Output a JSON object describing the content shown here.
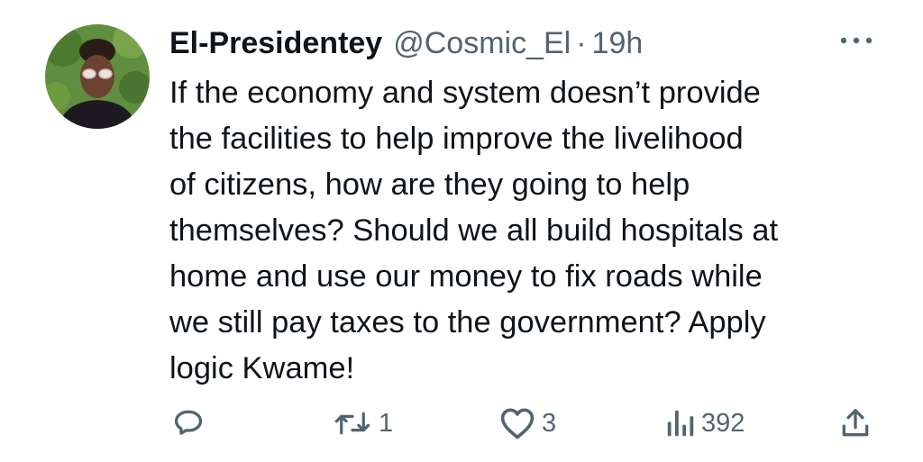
{
  "tweet": {
    "author": {
      "display_name": "El-Presidentey",
      "handle": "@Cosmic_El",
      "separator": "·",
      "time": "19h"
    },
    "text_lines": [
      "If the economy and system doesn’t provide",
      "the facilities to help improve the livelihood",
      "of citizens, how are they going to help",
      "themselves? Should we all build hospitals at",
      "home and use our money to fix roads while",
      "we still pay taxes to the government? Apply",
      "logic Kwame!"
    ],
    "actions": {
      "reply": {
        "icon": "reply-icon",
        "count": ""
      },
      "retweet": {
        "icon": "retweet-icon",
        "count": "1"
      },
      "like": {
        "icon": "heart-icon",
        "count": "3"
      },
      "views": {
        "icon": "views-icon",
        "count": "392"
      },
      "share": {
        "icon": "share-icon"
      }
    },
    "more": {
      "icon": "more-icon"
    }
  },
  "colors": {
    "text_primary": "#0f1419",
    "text_secondary": "#536471",
    "background": "#ffffff"
  }
}
